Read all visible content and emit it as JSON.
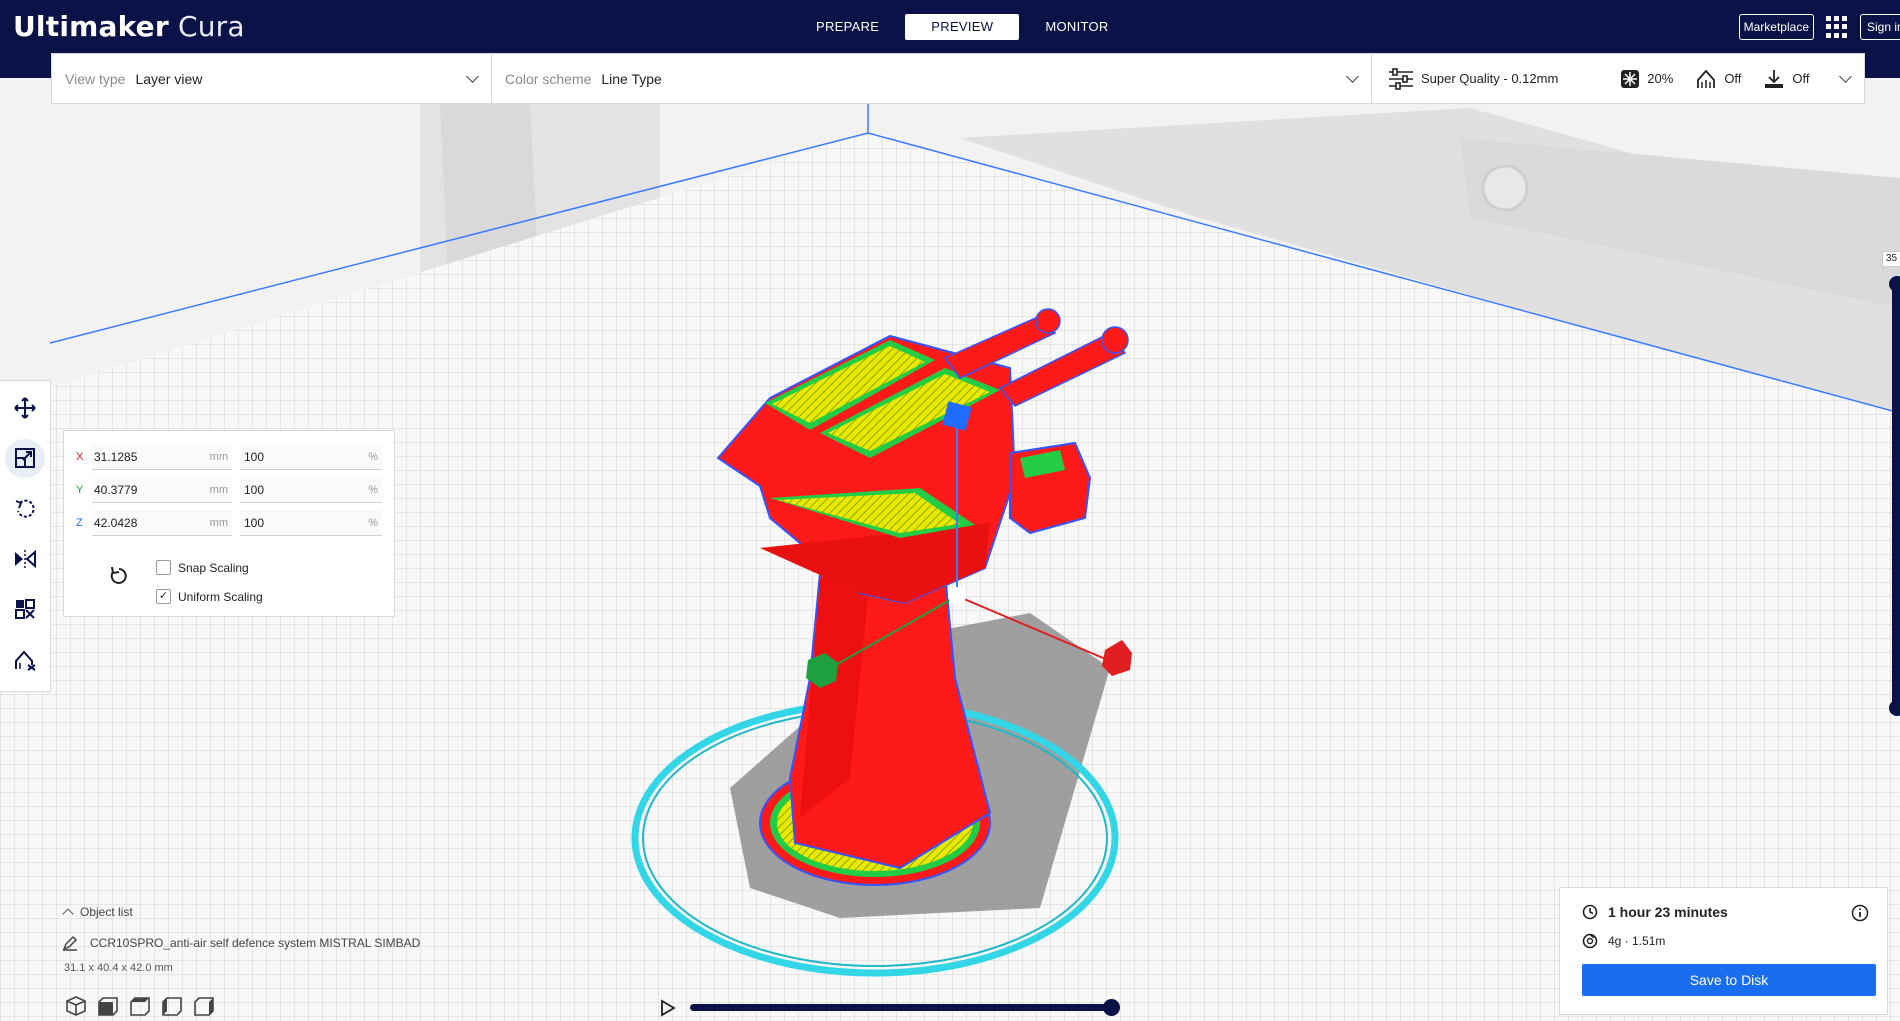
{
  "app": {
    "brand_bold": "Ultimaker",
    "brand_light": "Cura"
  },
  "header": {
    "stages": [
      {
        "label": "PREPARE"
      },
      {
        "label": "PREVIEW"
      },
      {
        "label": "MONITOR"
      }
    ],
    "active_stage": "PREVIEW",
    "marketplace_label": "Marketplace",
    "signin_label": "Sign in"
  },
  "topbar": {
    "view_type_label": "View type",
    "view_type_value": "Layer view",
    "color_scheme_label": "Color scheme",
    "color_scheme_value": "Line Type",
    "profile": "Super Quality - 0.12mm",
    "infill": "20%",
    "support": "Off",
    "adhesion": "Off"
  },
  "scale_tool": {
    "rows": [
      {
        "axis": "X",
        "mm": "31.1285",
        "mm_unit": "mm",
        "pct": "100",
        "pct_unit": "%"
      },
      {
        "axis": "Y",
        "mm": "40.3779",
        "mm_unit": "mm",
        "pct": "100",
        "pct_unit": "%"
      },
      {
        "axis": "Z",
        "mm": "42.0428",
        "mm_unit": "mm",
        "pct": "100",
        "pct_unit": "%"
      }
    ],
    "snap_scaling_label": "Snap Scaling",
    "snap_scaling_checked": false,
    "uniform_scaling_label": "Uniform Scaling",
    "uniform_scaling_checked": true,
    "check_mark": "✓"
  },
  "object_list": {
    "header": "Object list",
    "item": "CCR10SPRO_anti-air self defence system MISTRAL SIMBAD",
    "dimensions": "31.1 x 40.4 x 42.0 mm"
  },
  "layer_slider": {
    "current_layer_label": "35"
  },
  "print_summary": {
    "time": "1 hour 23 minutes",
    "material": "4g · 1.51m",
    "save_label": "Save to Disk"
  },
  "colors": {
    "header_bg": "#0b1247",
    "accent_blue": "#196ef0",
    "model_red": "#ff1a1a",
    "skirt_cyan": "#33d6e6",
    "infill_yellow": "#e6e600",
    "support_green": "#22cc44"
  },
  "icons": {
    "tools": [
      "move-icon",
      "scale-icon",
      "rotate-icon",
      "mirror-icon",
      "per-model-settings-icon",
      "support-blocker-icon"
    ]
  }
}
